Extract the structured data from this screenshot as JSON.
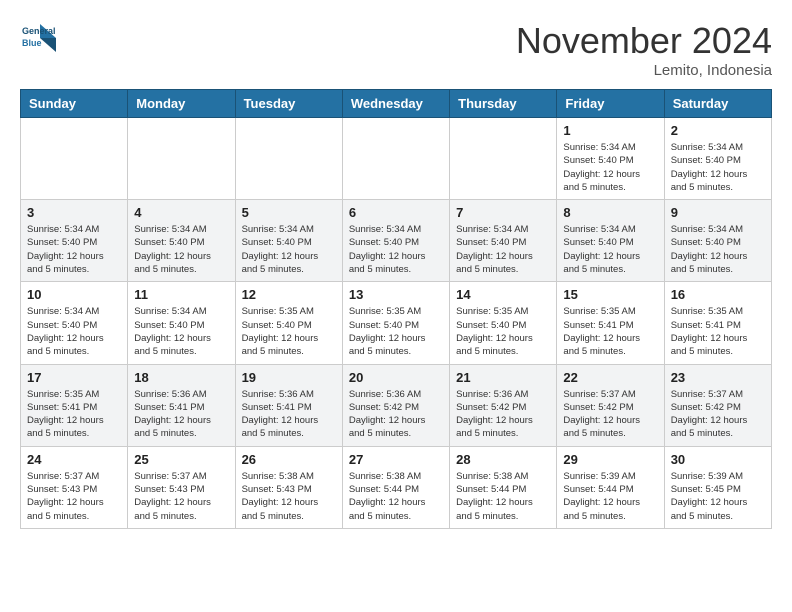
{
  "logo": {
    "text_line1": "General",
    "text_line2": "Blue"
  },
  "title": "November 2024",
  "location": "Lemito, Indonesia",
  "days_of_week": [
    "Sunday",
    "Monday",
    "Tuesday",
    "Wednesday",
    "Thursday",
    "Friday",
    "Saturday"
  ],
  "weeks": [
    [
      {
        "day": "",
        "info": ""
      },
      {
        "day": "",
        "info": ""
      },
      {
        "day": "",
        "info": ""
      },
      {
        "day": "",
        "info": ""
      },
      {
        "day": "",
        "info": ""
      },
      {
        "day": "1",
        "info": "Sunrise: 5:34 AM\nSunset: 5:40 PM\nDaylight: 12 hours and 5 minutes."
      },
      {
        "day": "2",
        "info": "Sunrise: 5:34 AM\nSunset: 5:40 PM\nDaylight: 12 hours and 5 minutes."
      }
    ],
    [
      {
        "day": "3",
        "info": "Sunrise: 5:34 AM\nSunset: 5:40 PM\nDaylight: 12 hours and 5 minutes."
      },
      {
        "day": "4",
        "info": "Sunrise: 5:34 AM\nSunset: 5:40 PM\nDaylight: 12 hours and 5 minutes."
      },
      {
        "day": "5",
        "info": "Sunrise: 5:34 AM\nSunset: 5:40 PM\nDaylight: 12 hours and 5 minutes."
      },
      {
        "day": "6",
        "info": "Sunrise: 5:34 AM\nSunset: 5:40 PM\nDaylight: 12 hours and 5 minutes."
      },
      {
        "day": "7",
        "info": "Sunrise: 5:34 AM\nSunset: 5:40 PM\nDaylight: 12 hours and 5 minutes."
      },
      {
        "day": "8",
        "info": "Sunrise: 5:34 AM\nSunset: 5:40 PM\nDaylight: 12 hours and 5 minutes."
      },
      {
        "day": "9",
        "info": "Sunrise: 5:34 AM\nSunset: 5:40 PM\nDaylight: 12 hours and 5 minutes."
      }
    ],
    [
      {
        "day": "10",
        "info": "Sunrise: 5:34 AM\nSunset: 5:40 PM\nDaylight: 12 hours and 5 minutes."
      },
      {
        "day": "11",
        "info": "Sunrise: 5:34 AM\nSunset: 5:40 PM\nDaylight: 12 hours and 5 minutes."
      },
      {
        "day": "12",
        "info": "Sunrise: 5:35 AM\nSunset: 5:40 PM\nDaylight: 12 hours and 5 minutes."
      },
      {
        "day": "13",
        "info": "Sunrise: 5:35 AM\nSunset: 5:40 PM\nDaylight: 12 hours and 5 minutes."
      },
      {
        "day": "14",
        "info": "Sunrise: 5:35 AM\nSunset: 5:40 PM\nDaylight: 12 hours and 5 minutes."
      },
      {
        "day": "15",
        "info": "Sunrise: 5:35 AM\nSunset: 5:41 PM\nDaylight: 12 hours and 5 minutes."
      },
      {
        "day": "16",
        "info": "Sunrise: 5:35 AM\nSunset: 5:41 PM\nDaylight: 12 hours and 5 minutes."
      }
    ],
    [
      {
        "day": "17",
        "info": "Sunrise: 5:35 AM\nSunset: 5:41 PM\nDaylight: 12 hours and 5 minutes."
      },
      {
        "day": "18",
        "info": "Sunrise: 5:36 AM\nSunset: 5:41 PM\nDaylight: 12 hours and 5 minutes."
      },
      {
        "day": "19",
        "info": "Sunrise: 5:36 AM\nSunset: 5:41 PM\nDaylight: 12 hours and 5 minutes."
      },
      {
        "day": "20",
        "info": "Sunrise: 5:36 AM\nSunset: 5:42 PM\nDaylight: 12 hours and 5 minutes."
      },
      {
        "day": "21",
        "info": "Sunrise: 5:36 AM\nSunset: 5:42 PM\nDaylight: 12 hours and 5 minutes."
      },
      {
        "day": "22",
        "info": "Sunrise: 5:37 AM\nSunset: 5:42 PM\nDaylight: 12 hours and 5 minutes."
      },
      {
        "day": "23",
        "info": "Sunrise: 5:37 AM\nSunset: 5:42 PM\nDaylight: 12 hours and 5 minutes."
      }
    ],
    [
      {
        "day": "24",
        "info": "Sunrise: 5:37 AM\nSunset: 5:43 PM\nDaylight: 12 hours and 5 minutes."
      },
      {
        "day": "25",
        "info": "Sunrise: 5:37 AM\nSunset: 5:43 PM\nDaylight: 12 hours and 5 minutes."
      },
      {
        "day": "26",
        "info": "Sunrise: 5:38 AM\nSunset: 5:43 PM\nDaylight: 12 hours and 5 minutes."
      },
      {
        "day": "27",
        "info": "Sunrise: 5:38 AM\nSunset: 5:44 PM\nDaylight: 12 hours and 5 minutes."
      },
      {
        "day": "28",
        "info": "Sunrise: 5:38 AM\nSunset: 5:44 PM\nDaylight: 12 hours and 5 minutes."
      },
      {
        "day": "29",
        "info": "Sunrise: 5:39 AM\nSunset: 5:44 PM\nDaylight: 12 hours and 5 minutes."
      },
      {
        "day": "30",
        "info": "Sunrise: 5:39 AM\nSunset: 5:45 PM\nDaylight: 12 hours and 5 minutes."
      }
    ]
  ]
}
